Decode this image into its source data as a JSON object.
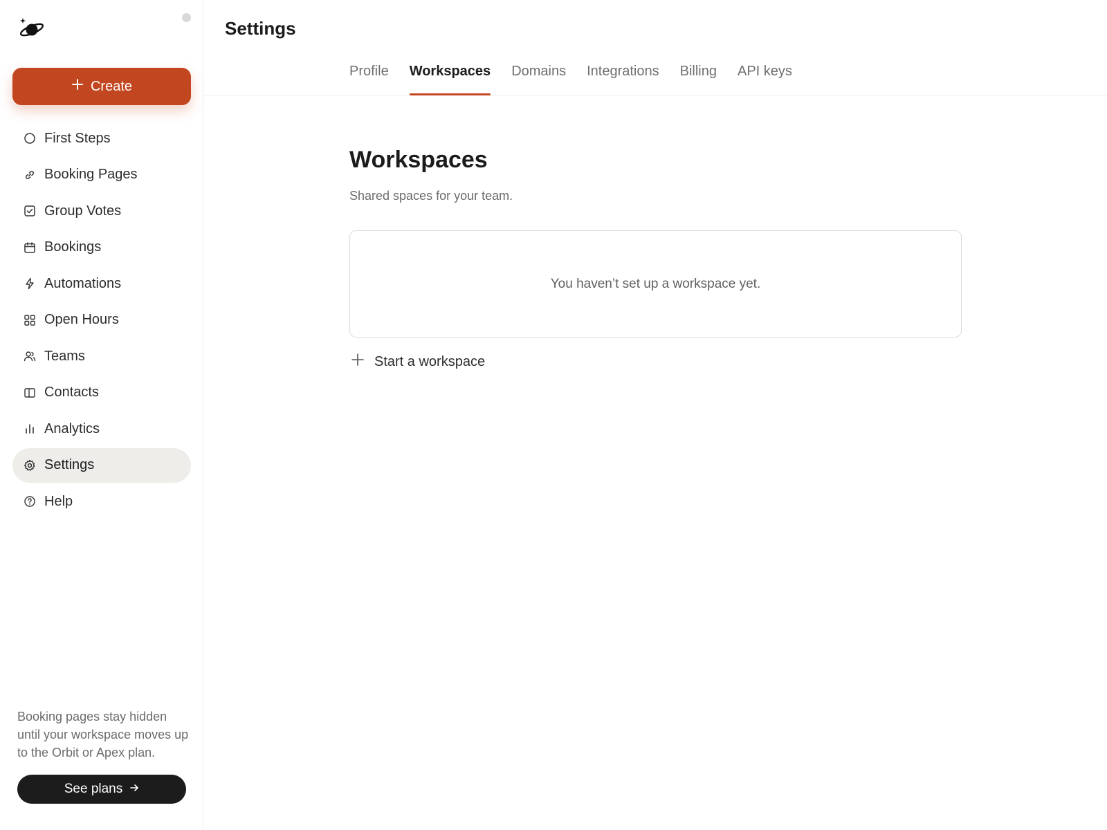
{
  "app": {
    "logo_icon": "planet-logo-icon",
    "create_label": "Create"
  },
  "sidebar": {
    "items": [
      {
        "label": "First Steps",
        "icon": "circle-icon",
        "active": false
      },
      {
        "label": "Booking Pages",
        "icon": "link-icon",
        "active": false
      },
      {
        "label": "Group Votes",
        "icon": "checkbox-icon",
        "active": false
      },
      {
        "label": "Bookings",
        "icon": "calendar-icon",
        "active": false
      },
      {
        "label": "Automations",
        "icon": "lightning-icon",
        "active": false
      },
      {
        "label": "Open Hours",
        "icon": "grid-icon",
        "active": false
      },
      {
        "label": "Teams",
        "icon": "users-icon",
        "active": false
      },
      {
        "label": "Contacts",
        "icon": "book-icon",
        "active": false
      },
      {
        "label": "Analytics",
        "icon": "bar-chart-icon",
        "active": false
      },
      {
        "label": "Settings",
        "icon": "gear-icon",
        "active": true
      },
      {
        "label": "Help",
        "icon": "help-circle-icon",
        "active": false
      }
    ],
    "upgrade_note": "Booking pages stay hidden until your workspace moves up to the Orbit or Apex plan.",
    "see_plans_label": "See plans"
  },
  "header": {
    "title": "Settings",
    "tabs": [
      {
        "label": "Profile",
        "active": false
      },
      {
        "label": "Workspaces",
        "active": true
      },
      {
        "label": "Domains",
        "active": false
      },
      {
        "label": "Integrations",
        "active": false
      },
      {
        "label": "Billing",
        "active": false
      },
      {
        "label": "API keys",
        "active": false
      }
    ]
  },
  "workspaces": {
    "title": "Workspaces",
    "subtitle": "Shared spaces for your team.",
    "empty_text": "You haven’t set up a workspace yet.",
    "start_label": "Start a workspace"
  },
  "colors": {
    "accent": "#c2461f",
    "active_bg": "#eeedea",
    "dark_button": "#1c1c1c"
  }
}
